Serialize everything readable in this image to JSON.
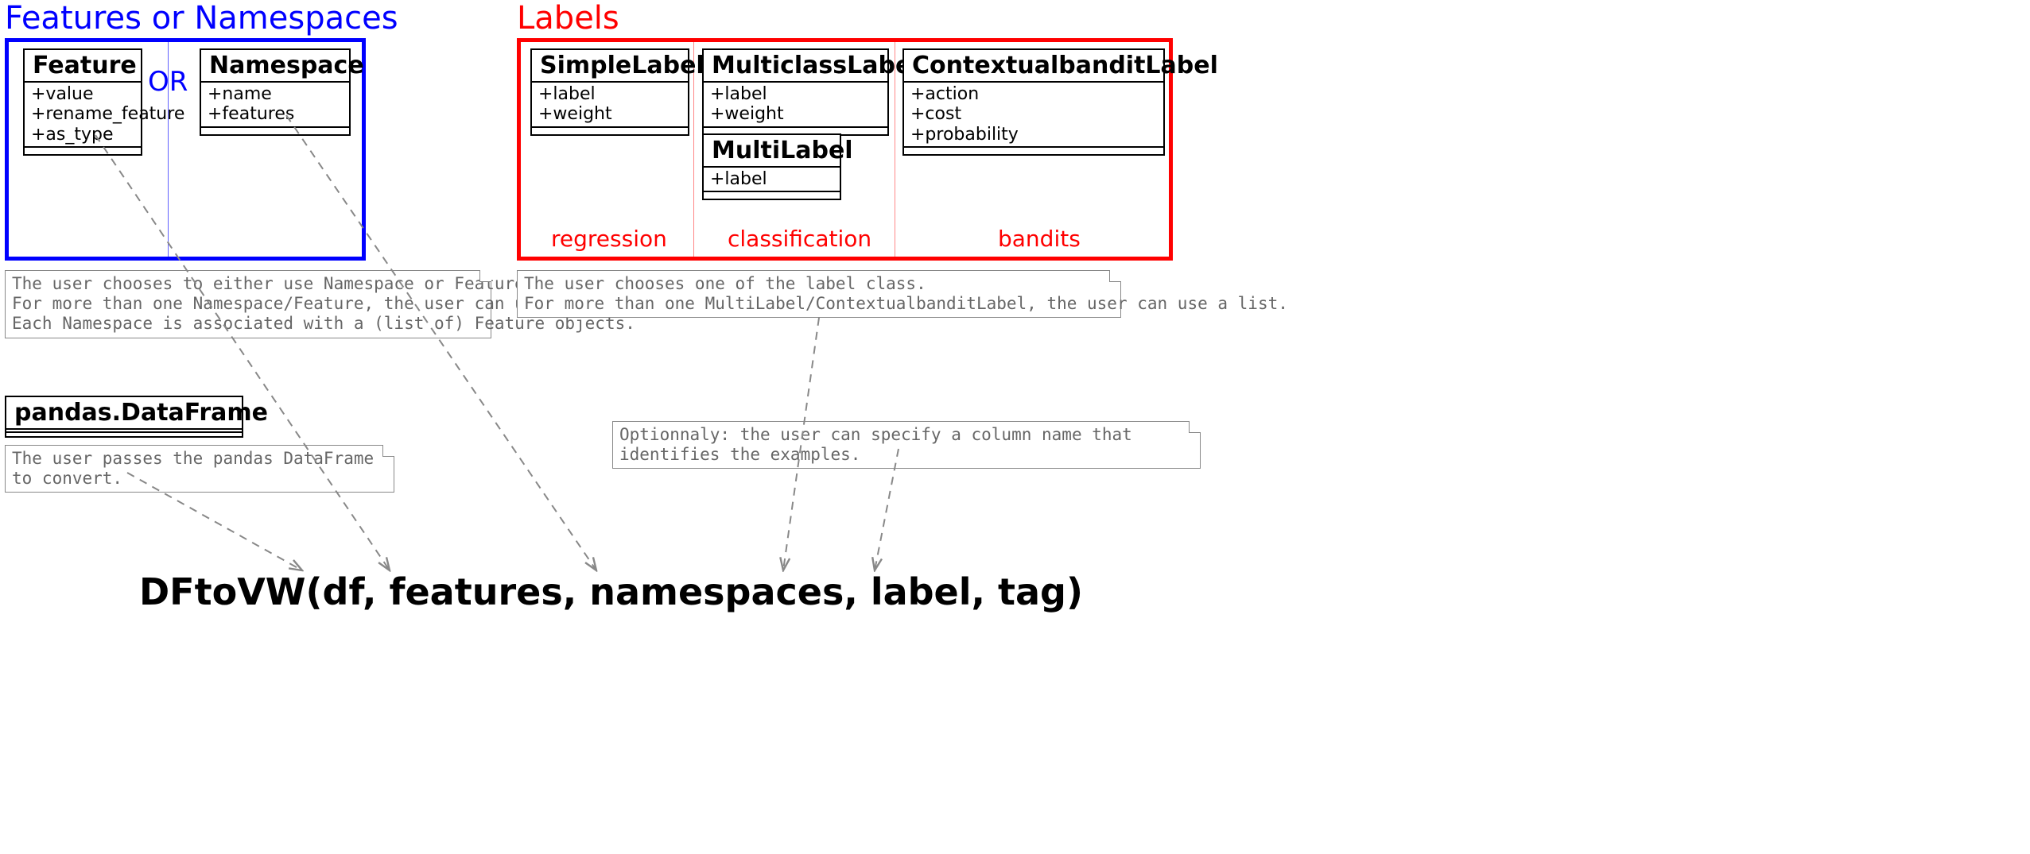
{
  "features_group": {
    "title": "Features or Namespaces",
    "or_label": "OR",
    "feature_class": {
      "name": "Feature",
      "attrs": [
        "+value",
        "+rename_feature",
        "+as_type"
      ]
    },
    "namespace_class": {
      "name": "Namespace",
      "attrs": [
        "+name",
        "+features"
      ]
    },
    "note": "The user chooses to either use Namespace or Feature class.\nFor more than one Namespace/Feature, the user can use a list.\nEach Namespace is associated with a (list of) Feature objects."
  },
  "labels_group": {
    "title": "Labels",
    "subgroups": {
      "regression": "regression",
      "classification": "classification",
      "bandits": "bandits"
    },
    "simple_label": {
      "name": "SimpleLabel",
      "attrs": [
        "+label",
        "+weight"
      ]
    },
    "multiclass_label": {
      "name": "MulticlassLabel",
      "attrs": [
        "+label",
        "+weight"
      ]
    },
    "multi_label": {
      "name": "MultiLabel",
      "attrs": [
        "+label"
      ]
    },
    "cb_label": {
      "name": "ContextualbanditLabel",
      "attrs": [
        "+action",
        "+cost",
        "+probability"
      ]
    },
    "note": "The user chooses one of the label class.\nFor more than one MultiLabel/ContextualbanditLabel, the user can use a list."
  },
  "dataframe": {
    "name": "pandas.DataFrame",
    "note": "The user passes the pandas DataFrame to convert."
  },
  "tag_note": "Optionnaly: the user can specify a column name that identifies the examples.",
  "signature": "DFtoVW(df, features, namespaces, label, tag)"
}
